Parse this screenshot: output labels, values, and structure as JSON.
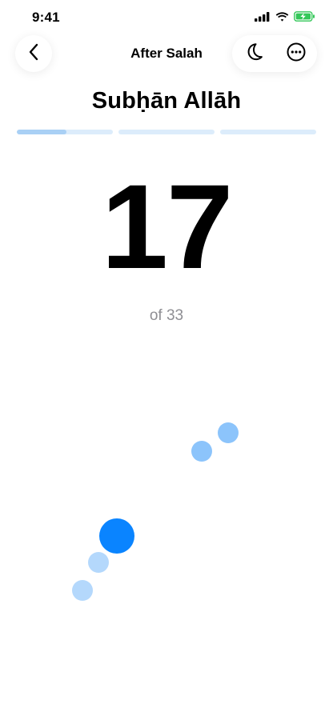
{
  "status_bar": {
    "time": "9:41",
    "icons": [
      "signal-icon",
      "wifi-icon",
      "battery-charging-icon"
    ]
  },
  "header": {
    "title": "After Salah",
    "back_icon": "chevron-left-icon",
    "theme_icon": "moon-icon",
    "more_icon": "more-horizontal-icon"
  },
  "dhikr": {
    "name": "Subḥān Allāh",
    "count": "17",
    "of_total": "of 33"
  },
  "progress": {
    "segments": [
      {
        "fill": 0.52
      },
      {
        "fill": 0
      },
      {
        "fill": 0
      }
    ]
  },
  "colors": {
    "accent": "#0a84ff",
    "bead_light": "#8cc4fb",
    "bead_pale": "#b4d8fc",
    "progress_track": "#dcecfb",
    "progress_fill": "#a9d0f5",
    "muted_text": "#8e8e93"
  }
}
